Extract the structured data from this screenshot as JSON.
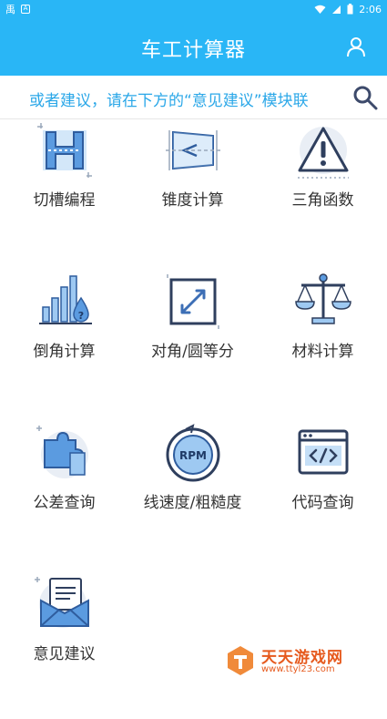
{
  "status_bar": {
    "left_glyph": "禹",
    "left_box": "A",
    "time": "2:06"
  },
  "header": {
    "title": "车工计算器"
  },
  "marquee": {
    "text": "或者建议，请在下方的“意见建议”模块联"
  },
  "grid": {
    "items": [
      {
        "label": "切槽编程",
        "icon": "grooving-icon"
      },
      {
        "label": "锥度计算",
        "icon": "taper-icon"
      },
      {
        "label": "三角函数",
        "icon": "warning-triangle-icon"
      },
      {
        "label": "倒角计算",
        "icon": "chamfer-chart-icon"
      },
      {
        "label": "对角/圆等分",
        "icon": "diagonal-arrow-icon"
      },
      {
        "label": "材料计算",
        "icon": "balance-scale-icon"
      },
      {
        "label": "公差查询",
        "icon": "puzzle-icon"
      },
      {
        "label": "线速度/粗糙度",
        "icon": "rpm-icon"
      },
      {
        "label": "代码查询",
        "icon": "code-window-icon"
      },
      {
        "label": "意见建议",
        "icon": "mail-letter-icon"
      }
    ]
  },
  "watermark": {
    "name": "天天游戏网",
    "url": "www.ttyl23.com"
  },
  "colors": {
    "primary": "#29b6f6",
    "icon_blue": "#3d6fb6",
    "icon_light": "#9ec9f2",
    "text": "#333333"
  }
}
